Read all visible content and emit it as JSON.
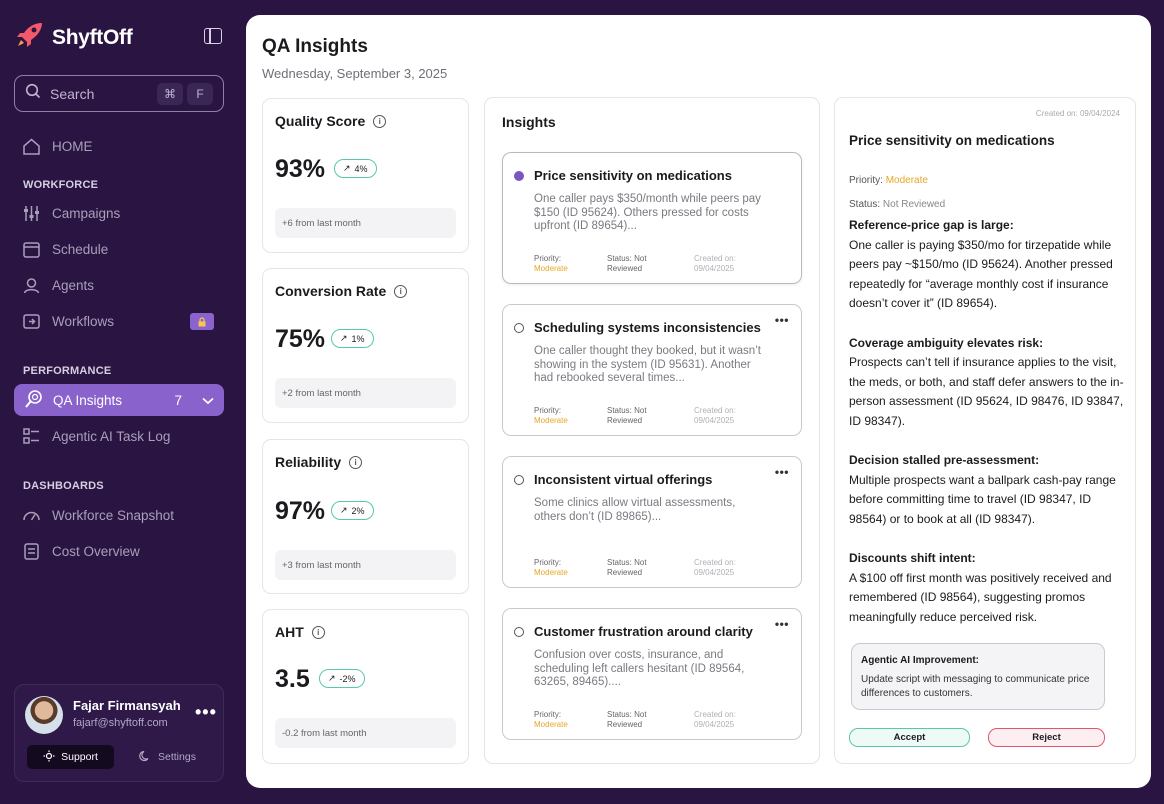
{
  "brand": {
    "name": "ShyftOff"
  },
  "search": {
    "placeholder": "Search",
    "shortcut_1": "⌘",
    "shortcut_2": "F"
  },
  "nav": {
    "home": "HOME",
    "workforce_label": "WORKFORCE",
    "campaigns": "Campaigns",
    "schedule": "Schedule",
    "agents": "Agents",
    "workflows": "Workflows",
    "performance_label": "PERFORMANCE",
    "qa_insights": "QA Insights",
    "qa_insights_count": "7",
    "agentic_log": "Agentic AI Task Log",
    "dashboards_label": "DASHBOARDS",
    "workforce_snapshot": "Workforce Snapshot",
    "cost_overview": "Cost Overview"
  },
  "user": {
    "name": "Fajar Firmansyah",
    "email": "fajarf@shyftoff.com",
    "support": "Support",
    "settings": "Settings"
  },
  "page": {
    "title": "QA Insights",
    "date": "Wednesday, September 3, 2025"
  },
  "metrics": [
    {
      "title": "Quality Score",
      "value": "93%",
      "change": "4%",
      "foot": "+6 from last month"
    },
    {
      "title": "Conversion Rate",
      "value": "75%",
      "change": "1%",
      "foot": "+2 from last month"
    },
    {
      "title": "Reliability",
      "value": "97%",
      "change": "2%",
      "foot": "+3 from last month"
    },
    {
      "title": "AHT",
      "value": "3.5",
      "change": "-2%",
      "foot": "-0.2 from last month"
    }
  ],
  "insights": {
    "title": "Insights",
    "priority_label": "Priority:",
    "status_label": "Status: Not",
    "status_label_2": "Reviewed",
    "created_label": "Created on:",
    "cards": [
      {
        "title": "Price sensitivity on medications",
        "desc": "One caller pays $350/month while peers pay $150 (ID 95624). Others pressed for costs upfront (ID 89654)...",
        "priority": "Moderate",
        "created": "09/04/2025"
      },
      {
        "title": "Scheduling systems inconsistencies",
        "desc": "One caller thought they booked, but it wasn’t showing in the system (ID 95631). Another had rebooked several times...",
        "priority": "Moderate",
        "created": "09/04/2025"
      },
      {
        "title": "Inconsistent virtual offerings",
        "desc": "Some clinics allow virtual assessments, others don’t (ID 89865)...",
        "priority": "Moderate",
        "created": "09/04/2025"
      },
      {
        "title": "Customer frustration around clarity",
        "desc": "Confusion over costs, insurance, and scheduling left callers hesitant (ID 89564, 63265, 89465)....",
        "priority": "Moderate",
        "created": "09/04/2025"
      }
    ]
  },
  "detail": {
    "created": "Created on: 09/04/2024",
    "title": "Price sensitivity on medications",
    "priority_label": "Priority:",
    "priority": "Moderate",
    "status_label": "Status:",
    "status": "Not Reviewed",
    "sections": [
      {
        "heading": "Reference-price gap is large:",
        "text": "One caller is paying $350/mo for tirzepatide while peers pay ~$150/mo (ID 95624). Another pressed repeatedly for “average monthly cost if insurance doesn’t cover it” (ID 89654)."
      },
      {
        "heading": "Coverage ambiguity elevates risk:",
        "text": "Prospects can’t tell if insurance applies to the visit, the meds, or both, and staff defer answers to the in-person assessment (ID 95624, ID 98476, ID 93847, ID 98347)."
      },
      {
        "heading": "Decision stalled pre-assessment:",
        "text": "Multiple prospects want a ballpark cash-pay range before committing time to travel (ID 98347, ID 98564) or to book at all (ID 98347)."
      },
      {
        "heading": "Discounts shift intent:",
        "text": "A $100 off first month was positively received and remembered (ID 98564), suggesting promos meaningfully reduce perceived risk."
      }
    ],
    "agentic_title": "Agentic AI Improvement:",
    "agentic_text": "Update script with messaging to communicate price differences to customers.",
    "accept": "Accept",
    "reject": "Reject"
  },
  "colors": {
    "bg": "#2a1542",
    "accent": "#8a62cc",
    "moderate": "#e7a626",
    "positive": "#58c7ad",
    "negative": "#e0566b"
  }
}
